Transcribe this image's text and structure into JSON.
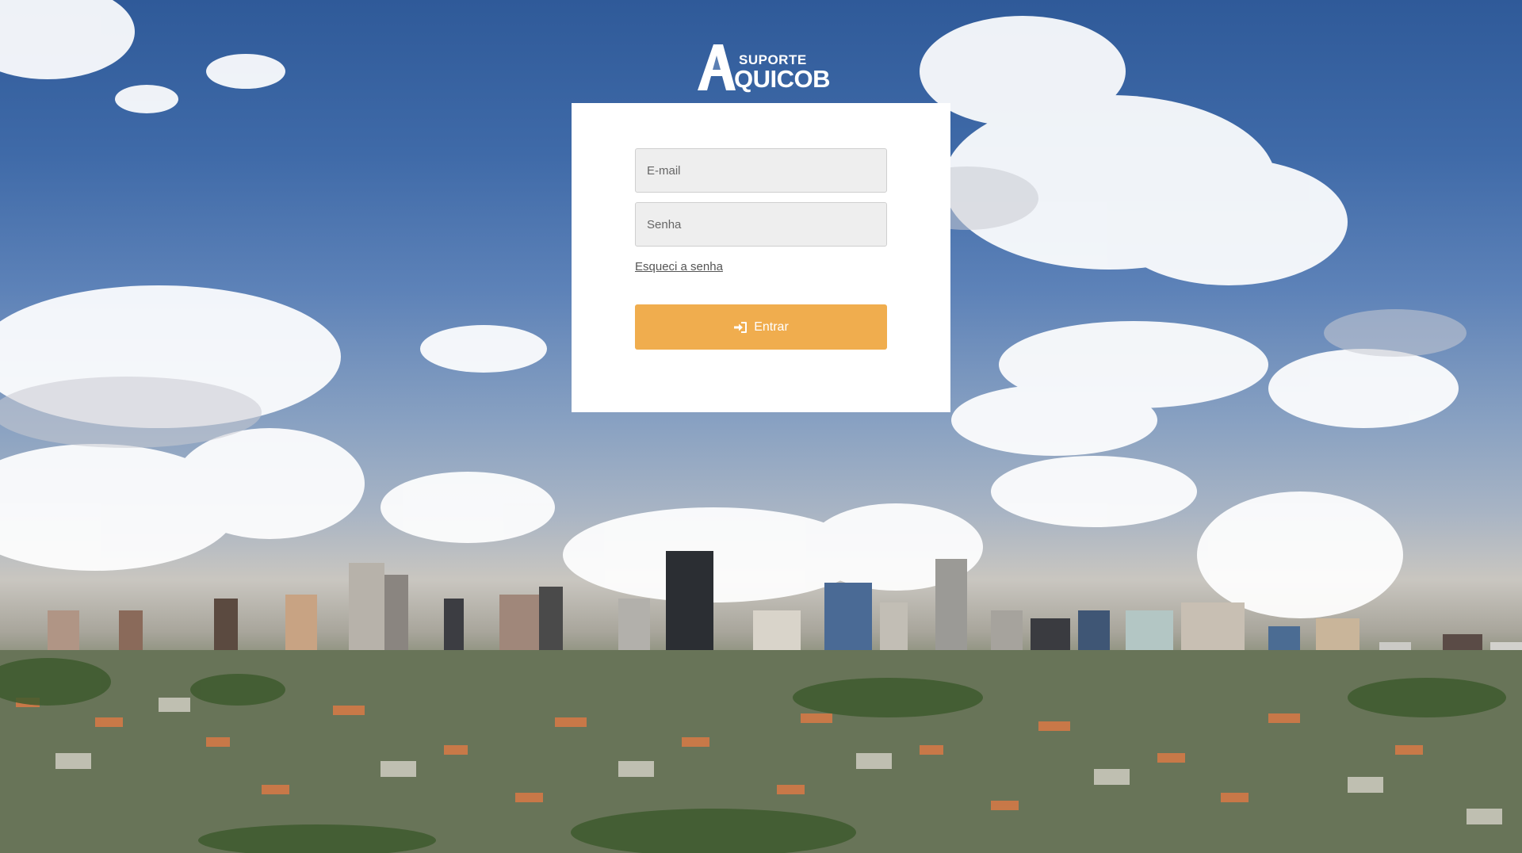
{
  "brand": {
    "top_word": "SUPORTE",
    "bottom_word": "QUICOB",
    "mark_letter": "A"
  },
  "login": {
    "email_placeholder": "E-mail",
    "password_placeholder": "Senha",
    "forgot_label": "Esqueci a senha",
    "submit_label": "Entrar",
    "submit_icon": "sign-in-icon"
  },
  "colors": {
    "button": "#f0ad4e",
    "card": "#ffffff",
    "input_bg": "#eeeeee"
  }
}
